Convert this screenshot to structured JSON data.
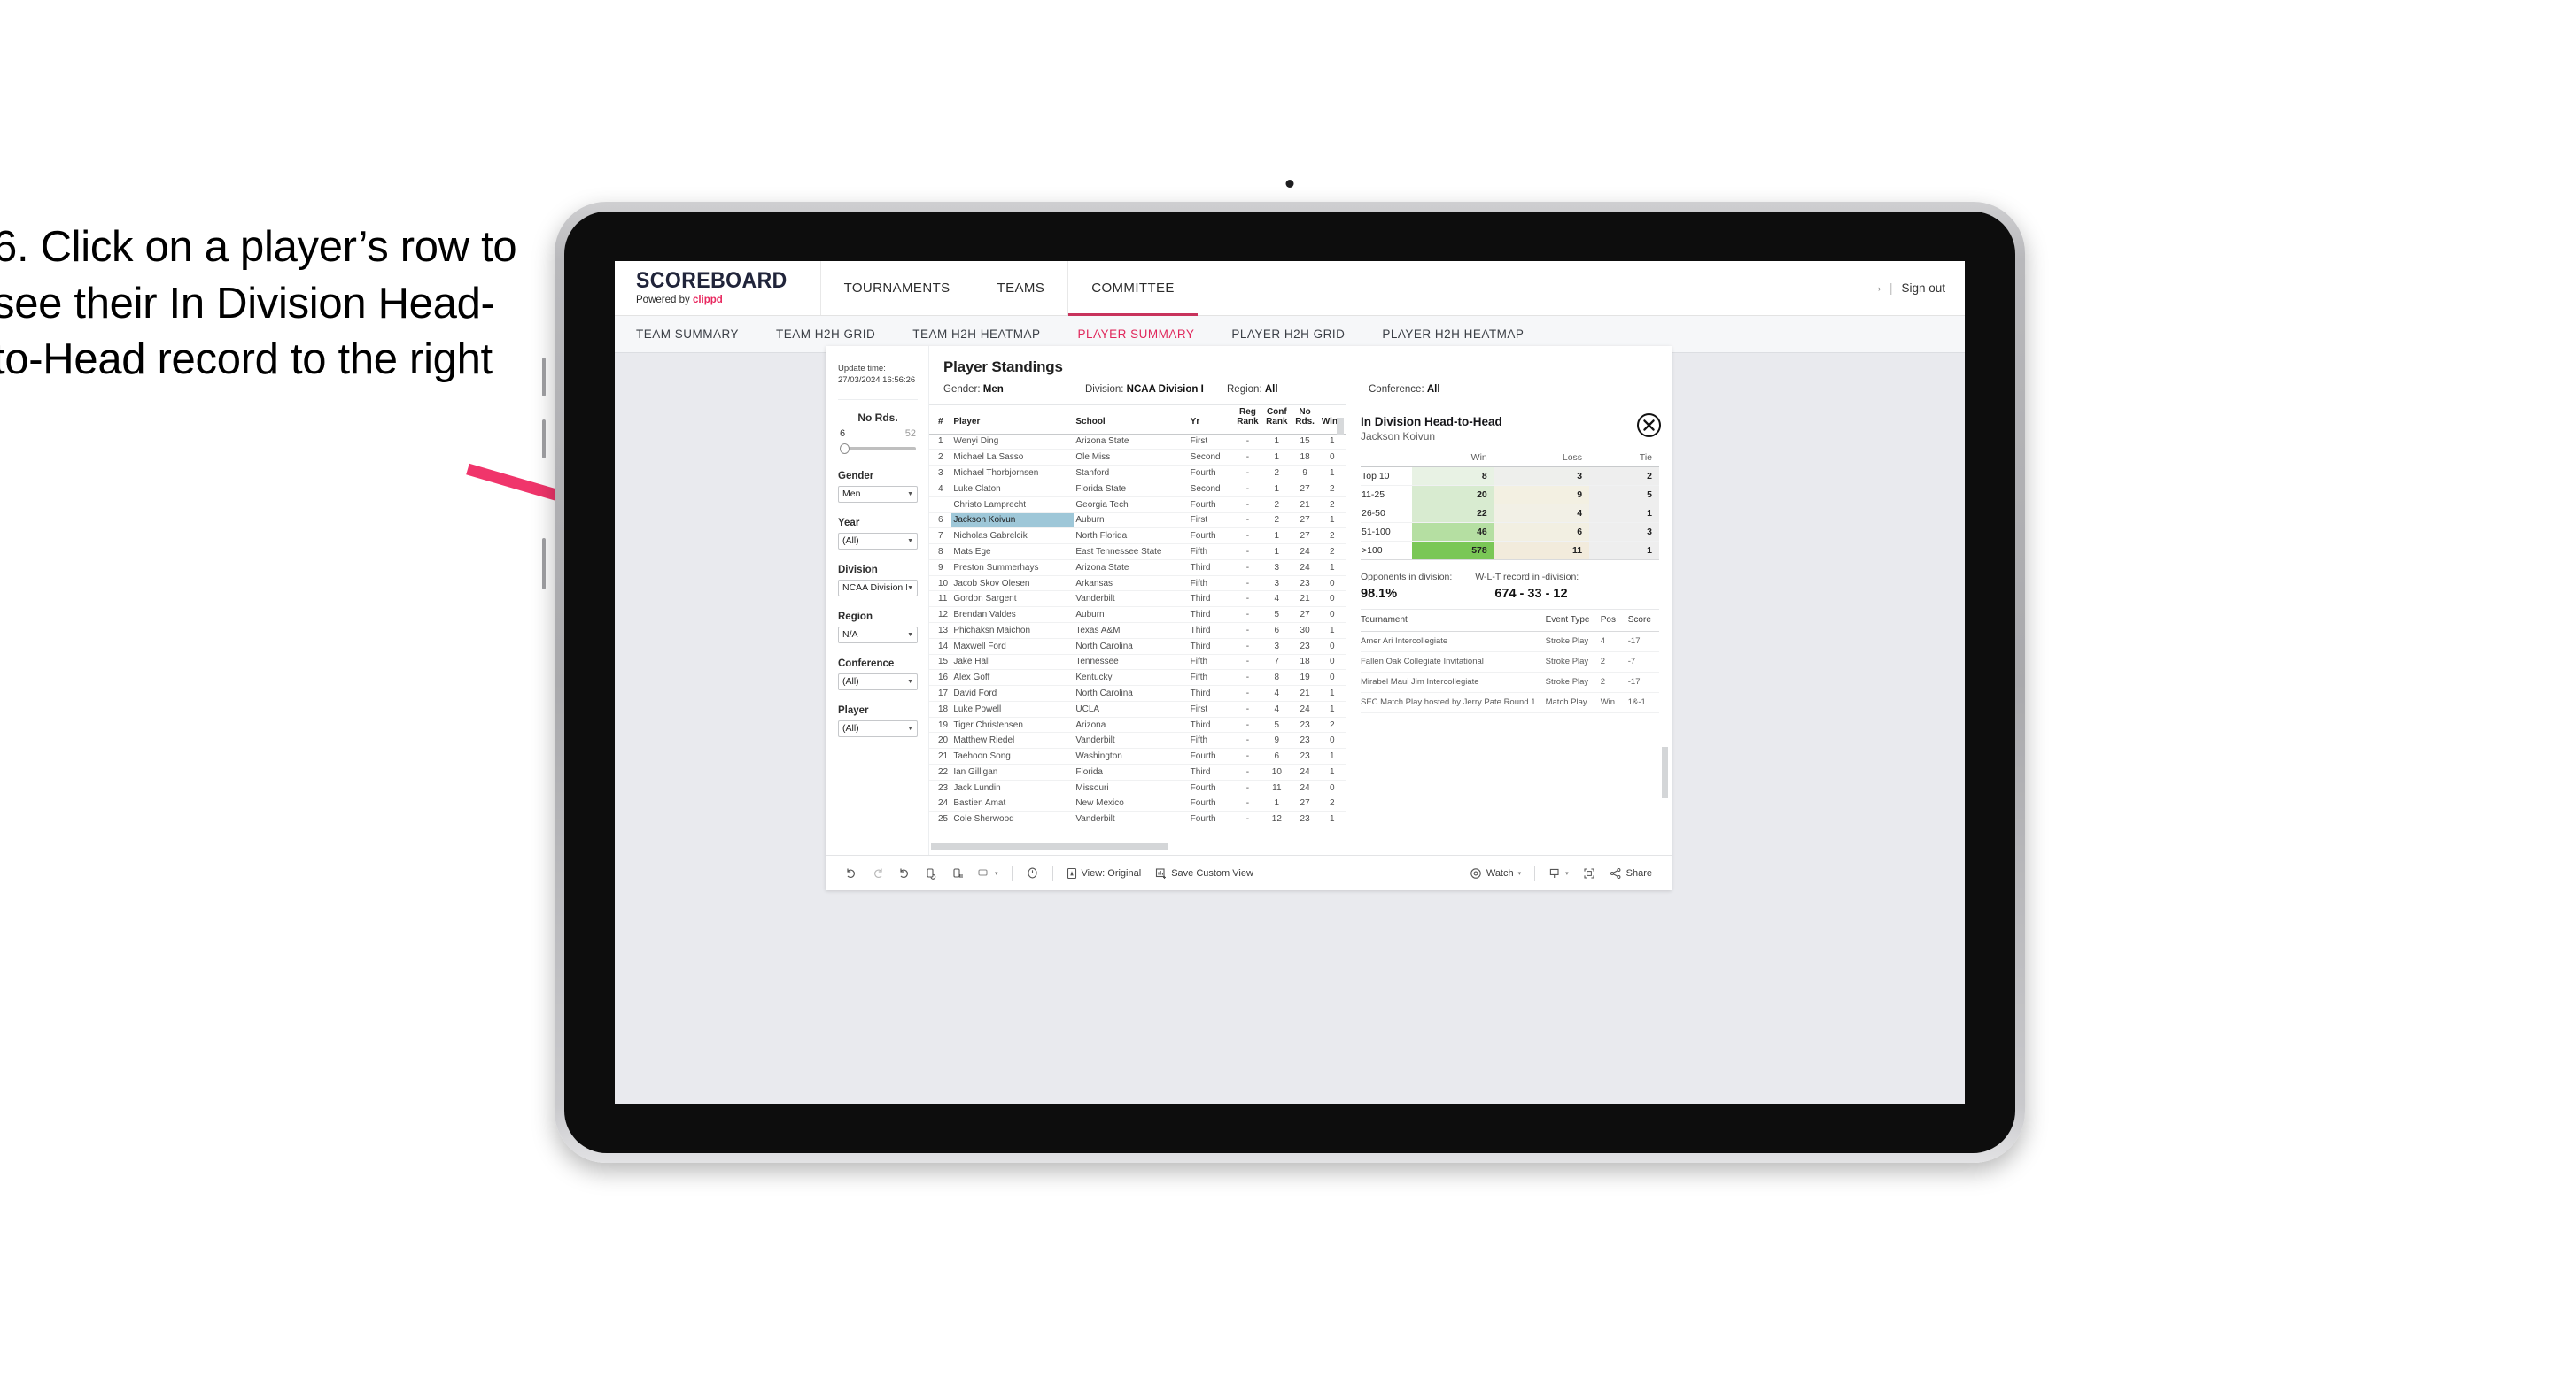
{
  "instruction": {
    "text": "6. Click on a player’s row to see their In Division Head-to-Head record to the right"
  },
  "colors": {
    "accent_pink": "#e0285c",
    "brand_navy": "#20243a",
    "arrow_pink": "#f0356b",
    "selected_row": "#9ec7d8",
    "heat_green_max": "#7ac756",
    "tablet_bezel": "#0d0d0d"
  },
  "appbar": {
    "brand_name": "SCOREBOARD",
    "brand_powered_prefix": "Powered by ",
    "brand_powered_company": "clippd",
    "nav": [
      {
        "label": "TOURNAMENTS",
        "active": false
      },
      {
        "label": "TEAMS",
        "active": false
      },
      {
        "label": "COMMITTEE",
        "active": true
      }
    ],
    "caret": "›",
    "separator": "|",
    "sign_out": "Sign out"
  },
  "subnav": [
    {
      "label": "TEAM SUMMARY",
      "active": false
    },
    {
      "label": "TEAM H2H GRID",
      "active": false
    },
    {
      "label": "TEAM H2H HEATMAP",
      "active": false
    },
    {
      "label": "PLAYER SUMMARY",
      "active": true
    },
    {
      "label": "PLAYER H2H GRID",
      "active": false
    },
    {
      "label": "PLAYER H2H HEATMAP",
      "active": false
    }
  ],
  "filters": {
    "update_label": "Update time:",
    "update_value": "27/03/2024 16:56:26",
    "slider": {
      "title": "No Rds.",
      "min": "6",
      "max": "52",
      "position_pct": 4
    },
    "selects": [
      {
        "label": "Gender",
        "value": "Men"
      },
      {
        "label": "Year",
        "value": "(All)"
      },
      {
        "label": "Division",
        "value": "NCAA Division I"
      },
      {
        "label": "Region",
        "value": "N/A"
      },
      {
        "label": "Conference",
        "value": "(All)"
      },
      {
        "label": "Player",
        "value": "(All)"
      }
    ]
  },
  "standings": {
    "title": "Player Standings",
    "summary_filters": [
      {
        "label": "Gender:",
        "value": "Men"
      },
      {
        "label": "Division:",
        "value": "NCAA Division I"
      },
      {
        "label": "Region:",
        "value": "All"
      },
      {
        "label": "Conference:",
        "value": "All"
      }
    ],
    "columns": [
      "#",
      "Player",
      "School",
      "Yr",
      "Reg Rank",
      "Conf Rank",
      "No Rds.",
      "Wins"
    ],
    "columns_wrapped": [
      {
        "l1": "#",
        "l2": ""
      },
      {
        "l1": "Player",
        "l2": ""
      },
      {
        "l1": "School",
        "l2": ""
      },
      {
        "l1": "Yr",
        "l2": ""
      },
      {
        "l1": "Reg",
        "l2": "Rank"
      },
      {
        "l1": "Conf",
        "l2": "Rank"
      },
      {
        "l1": "No",
        "l2": "Rds."
      },
      {
        "l1": "Wins",
        "l2": ""
      }
    ],
    "rows": [
      {
        "rank": "1",
        "player": "Wenyi Ding",
        "school": "Arizona State",
        "yr": "First",
        "reg": "-",
        "conf": "1",
        "rds": "15",
        "wins": "1",
        "selected": false
      },
      {
        "rank": "2",
        "player": "Michael La Sasso",
        "school": "Ole Miss",
        "yr": "Second",
        "reg": "-",
        "conf": "1",
        "rds": "18",
        "wins": "0",
        "selected": false
      },
      {
        "rank": "3",
        "player": "Michael Thorbjornsen",
        "school": "Stanford",
        "yr": "Fourth",
        "reg": "-",
        "conf": "2",
        "rds": "9",
        "wins": "1",
        "selected": false
      },
      {
        "rank": "4",
        "player": "Luke Claton",
        "school": "Florida State",
        "yr": "Second",
        "reg": "-",
        "conf": "1",
        "rds": "27",
        "wins": "2",
        "selected": false
      },
      {
        "rank": "",
        "player": "Christo Lamprecht",
        "school": "Georgia Tech",
        "yr": "Fourth",
        "reg": "-",
        "conf": "2",
        "rds": "21",
        "wins": "2",
        "selected": false
      },
      {
        "rank": "6",
        "player": "Jackson Koivun",
        "school": "Auburn",
        "yr": "First",
        "reg": "-",
        "conf": "2",
        "rds": "27",
        "wins": "1",
        "selected": true
      },
      {
        "rank": "7",
        "player": "Nicholas Gabrelcik",
        "school": "North Florida",
        "yr": "Fourth",
        "reg": "-",
        "conf": "1",
        "rds": "27",
        "wins": "2",
        "selected": false
      },
      {
        "rank": "8",
        "player": "Mats Ege",
        "school": "East Tennessee State",
        "yr": "Fifth",
        "reg": "-",
        "conf": "1",
        "rds": "24",
        "wins": "2",
        "selected": false
      },
      {
        "rank": "9",
        "player": "Preston Summerhays",
        "school": "Arizona State",
        "yr": "Third",
        "reg": "-",
        "conf": "3",
        "rds": "24",
        "wins": "1",
        "selected": false
      },
      {
        "rank": "10",
        "player": "Jacob Skov Olesen",
        "school": "Arkansas",
        "yr": "Fifth",
        "reg": "-",
        "conf": "3",
        "rds": "23",
        "wins": "0",
        "selected": false
      },
      {
        "rank": "11",
        "player": "Gordon Sargent",
        "school": "Vanderbilt",
        "yr": "Third",
        "reg": "-",
        "conf": "4",
        "rds": "21",
        "wins": "0",
        "selected": false
      },
      {
        "rank": "12",
        "player": "Brendan Valdes",
        "school": "Auburn",
        "yr": "Third",
        "reg": "-",
        "conf": "5",
        "rds": "27",
        "wins": "0",
        "selected": false
      },
      {
        "rank": "13",
        "player": "Phichaksn Maichon",
        "school": "Texas A&M",
        "yr": "Third",
        "reg": "-",
        "conf": "6",
        "rds": "30",
        "wins": "1",
        "selected": false
      },
      {
        "rank": "14",
        "player": "Maxwell Ford",
        "school": "North Carolina",
        "yr": "Third",
        "reg": "-",
        "conf": "3",
        "rds": "23",
        "wins": "0",
        "selected": false
      },
      {
        "rank": "15",
        "player": "Jake Hall",
        "school": "Tennessee",
        "yr": "Fifth",
        "reg": "-",
        "conf": "7",
        "rds": "18",
        "wins": "0",
        "selected": false
      },
      {
        "rank": "16",
        "player": "Alex Goff",
        "school": "Kentucky",
        "yr": "Fifth",
        "reg": "-",
        "conf": "8",
        "rds": "19",
        "wins": "0",
        "selected": false
      },
      {
        "rank": "17",
        "player": "David Ford",
        "school": "North Carolina",
        "yr": "Third",
        "reg": "-",
        "conf": "4",
        "rds": "21",
        "wins": "1",
        "selected": false
      },
      {
        "rank": "18",
        "player": "Luke Powell",
        "school": "UCLA",
        "yr": "First",
        "reg": "-",
        "conf": "4",
        "rds": "24",
        "wins": "1",
        "selected": false
      },
      {
        "rank": "19",
        "player": "Tiger Christensen",
        "school": "Arizona",
        "yr": "Third",
        "reg": "-",
        "conf": "5",
        "rds": "23",
        "wins": "2",
        "selected": false
      },
      {
        "rank": "20",
        "player": "Matthew Riedel",
        "school": "Vanderbilt",
        "yr": "Fifth",
        "reg": "-",
        "conf": "9",
        "rds": "23",
        "wins": "0",
        "selected": false
      },
      {
        "rank": "21",
        "player": "Taehoon Song",
        "school": "Washington",
        "yr": "Fourth",
        "reg": "-",
        "conf": "6",
        "rds": "23",
        "wins": "1",
        "selected": false
      },
      {
        "rank": "22",
        "player": "Ian Gilligan",
        "school": "Florida",
        "yr": "Third",
        "reg": "-",
        "conf": "10",
        "rds": "24",
        "wins": "1",
        "selected": false
      },
      {
        "rank": "23",
        "player": "Jack Lundin",
        "school": "Missouri",
        "yr": "Fourth",
        "reg": "-",
        "conf": "11",
        "rds": "24",
        "wins": "0",
        "selected": false
      },
      {
        "rank": "24",
        "player": "Bastien Amat",
        "school": "New Mexico",
        "yr": "Fourth",
        "reg": "-",
        "conf": "1",
        "rds": "27",
        "wins": "2",
        "selected": false
      },
      {
        "rank": "25",
        "player": "Cole Sherwood",
        "school": "Vanderbilt",
        "yr": "Fourth",
        "reg": "-",
        "conf": "12",
        "rds": "23",
        "wins": "1",
        "selected": false
      }
    ]
  },
  "h2h": {
    "title": "In Division Head-to-Head",
    "player": "Jackson Koivun",
    "close_icon": "close-circle-icon",
    "matrix": {
      "columns": [
        "Win",
        "Loss",
        "Tie"
      ],
      "rows": [
        {
          "bucket": "Top 10",
          "win": "8",
          "loss": "3",
          "tie": "2",
          "win_bg": "#e8f2e4",
          "loss_bg": "#eeefec",
          "tie_bg": "#eeeeee"
        },
        {
          "bucket": "11-25",
          "win": "20",
          "loss": "9",
          "tie": "5",
          "win_bg": "#d8ebd0",
          "loss_bg": "#f3f0e2",
          "tie_bg": "#eeeeee"
        },
        {
          "bucket": "26-50",
          "win": "22",
          "loss": "4",
          "tie": "1",
          "win_bg": "#d8ebd0",
          "loss_bg": "#f2f0e6",
          "tie_bg": "#eeeeee"
        },
        {
          "bucket": "51-100",
          "win": "46",
          "loss": "6",
          "tie": "3",
          "win_bg": "#b5dfa2",
          "loss_bg": "#f2efe2",
          "tie_bg": "#eeeeee"
        },
        {
          "bucket": ">100",
          "win": "578",
          "loss": "11",
          "tie": "1",
          "win_bg": "#7ac756",
          "loss_bg": "#f2ebdc",
          "tie_bg": "#eeeeee"
        }
      ]
    },
    "summary": [
      {
        "label": "Opponents in division:",
        "value": "98.1%"
      },
      {
        "label": "W-L-T record in -division:",
        "value": "674 - 33 - 12"
      }
    ],
    "tournaments": {
      "columns": [
        "Tournament",
        "Event Type",
        "Pos",
        "Score"
      ],
      "rows": [
        {
          "tournament": "Amer Ari Intercollegiate",
          "event_type": "Stroke Play",
          "pos": "4",
          "score": "-17"
        },
        {
          "tournament": "Fallen Oak Collegiate Invitational",
          "event_type": "Stroke Play",
          "pos": "2",
          "score": "-7"
        },
        {
          "tournament": "Mirabel Maui Jim Intercollegiate",
          "event_type": "Stroke Play",
          "pos": "2",
          "score": "-17"
        },
        {
          "tournament": "SEC Match Play hosted by Jerry Pate Round 1",
          "event_type": "Match Play",
          "pos": "Win",
          "score": "1&-1"
        }
      ]
    }
  },
  "toolbar": {
    "undo": "undo-icon",
    "redo": "redo-icon",
    "revert": "revert-icon",
    "refresh": "refresh-data-icon",
    "pause": "pause-auto-update-icon",
    "device_layout": "device-layout-icon",
    "device_caret": "▾",
    "clock": "clock-history-icon",
    "view_label": "View: Original",
    "save_label": "Save Custom View",
    "watch_label": "Watch",
    "watch_caret": "▾",
    "download_caret": "▾",
    "share_label": "Share"
  }
}
